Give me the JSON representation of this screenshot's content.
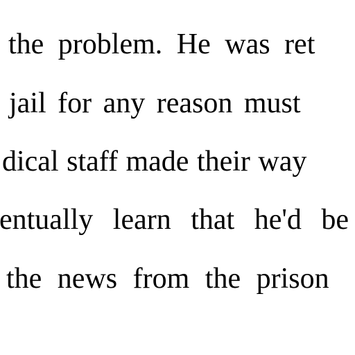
{
  "document": {
    "lines": [
      "the problem. He was ret",
      "jail for any reason must",
      "dical staff made their way",
      "entually learn that he'd be",
      "the news from the prison"
    ]
  }
}
